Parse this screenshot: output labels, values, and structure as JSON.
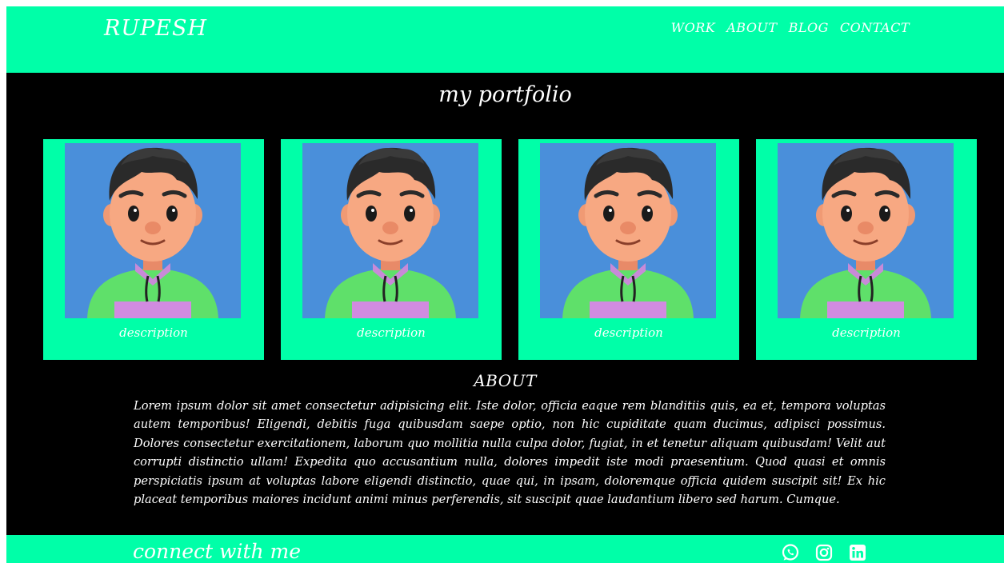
{
  "header": {
    "brand": "RUPESH",
    "nav": [
      "WORK",
      "ABOUT",
      "BLOG",
      "CONTACT"
    ]
  },
  "portfolio": {
    "title": "my portfolio",
    "cards": [
      {
        "description": "description"
      },
      {
        "description": "description"
      },
      {
        "description": "description"
      },
      {
        "description": "description"
      }
    ]
  },
  "about": {
    "title": "ABOUT",
    "text": "Lorem ipsum dolor sit amet consectetur adipisicing elit. Iste dolor, officia eaque rem blanditiis quis, ea et, tempora voluptas autem temporibus! Eligendi, debitis fuga quibusdam saepe optio, non hic cupiditate quam ducimus, adipisci possimus. Dolores consectetur exercitationem, laborum quo mollitia nulla culpa dolor, fugiat, in et tenetur aliquam quibusdam! Velit aut corrupti distinctio ullam! Expedita quo accusantium nulla, dolores impedit iste modi praesentium. Quod quasi et omnis perspiciatis ipsum at voluptas labore eligendi distinctio, quae qui, in ipsam, doloremque officia quidem suscipit sit! Ex hic placeat temporibus maiores incidunt animi minus perferendis, sit suscipit quae laudantium libero sed harum. Cumque."
  },
  "footer": {
    "connect": "connect with me",
    "icons": [
      "whatsapp-icon",
      "instagram-icon",
      "linkedin-icon"
    ]
  },
  "colors": {
    "accent": "#00ffa8",
    "background": "#000000",
    "photo_bg": "#4a8fda",
    "text": "#ffffff"
  }
}
